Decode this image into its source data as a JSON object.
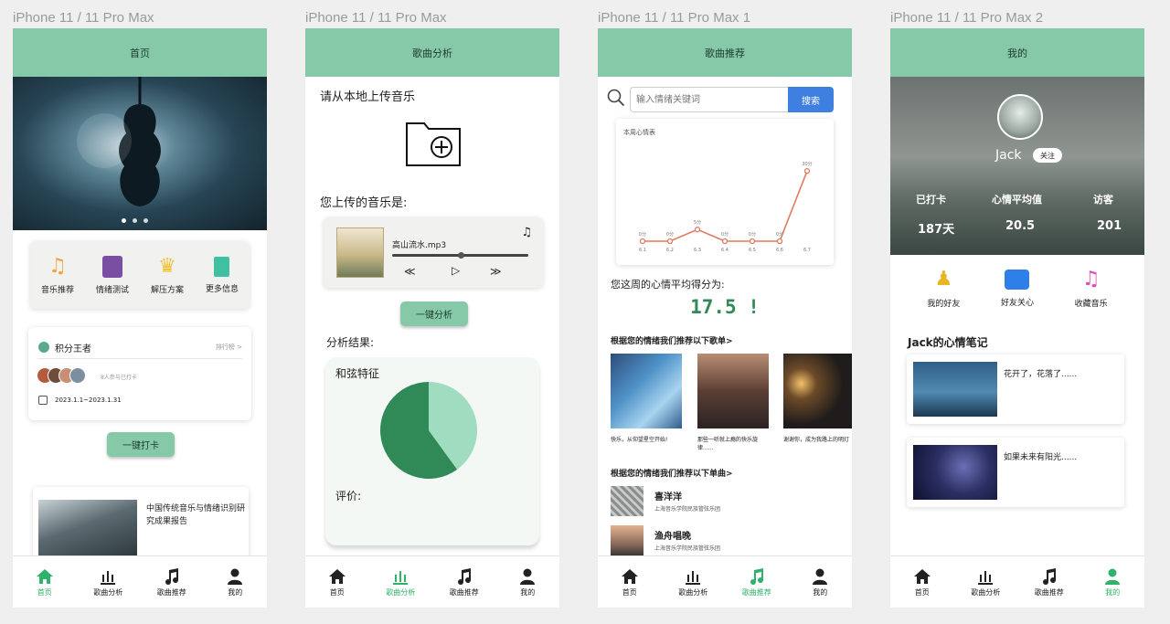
{
  "frames": [
    {
      "label": "iPhone 11 / 11 Pro Max",
      "title": "首页"
    },
    {
      "label": "iPhone 11 / 11 Pro Max",
      "title": "歌曲分析"
    },
    {
      "label": "iPhone 11 / 11 Pro Max 1",
      "title": "歌曲推荐"
    },
    {
      "label": "iPhone 11 / 11 Pro Max 2",
      "title": "我的"
    }
  ],
  "tabs": [
    "首页",
    "歌曲分析",
    "歌曲推荐",
    "我的"
  ],
  "home": {
    "features": [
      "音乐推荐",
      "情绪测试",
      "解压方案",
      "更多信息"
    ],
    "rank_title": "积分王者",
    "rank_link": "排行榜 >",
    "rank_count": "8人参与已打卡",
    "rank_date": "2023.1.1~2023.1.31",
    "checkin_button": "一键打卡",
    "report_title": "中国传统音乐与情绪识别研究成果报告"
  },
  "analysis": {
    "upload_prompt": "请从本地上传音乐",
    "uploaded_label": "您上传的音乐是:",
    "file_name": "高山流水.mp3",
    "progress": 0.5,
    "analyze_button": "一键分析",
    "result_label": "分析结果:",
    "feature_label": "和弦特征",
    "eval_label": "评价:",
    "pie": {
      "light_share": 0.4,
      "light_color": "#9fdcc0",
      "dark_color": "#2f8a58"
    }
  },
  "recommend": {
    "search_placeholder": "输入情绪关键词",
    "search_button": "搜索",
    "chart_title": "本周心情表",
    "score_label": "您这周的心情平均得分为:",
    "score": "17.5 !",
    "playlist_heading": "根据您的情绪我们推荐以下歌单>",
    "playlists": [
      "快乐，从仰望星空开始!",
      "那些一听就上瘾的快乐旋律......",
      "谢谢你，成为我路上的明灯"
    ],
    "single_heading": "根据您的情绪我们推荐以下单曲>",
    "singles": [
      {
        "title": "喜洋洋",
        "artist": "上海音乐学院民族管弦乐团"
      },
      {
        "title": "渔舟唱晚",
        "artist": "上海音乐学院民族管弦乐团"
      }
    ]
  },
  "chart_data": {
    "type": "line",
    "title": "本周心情表",
    "categories": [
      "6.1",
      "6.2",
      "6.3",
      "6.4",
      "6.5",
      "6.6",
      "6.7"
    ],
    "series": [
      {
        "values": [
          0,
          0,
          5,
          0,
          0,
          0,
          30
        ]
      }
    ],
    "data_labels": [
      "0分",
      "0分",
      "5分",
      "0分",
      "0分",
      "0分",
      "30分"
    ],
    "ylim": [
      0,
      32
    ],
    "color": "#e07a5f"
  },
  "mine": {
    "name": "Jack",
    "follow_button": "关注",
    "stats": [
      {
        "label": "已打卡",
        "value": "187天"
      },
      {
        "label": "心情平均值",
        "value": "20.5"
      },
      {
        "label": "访客",
        "value": "201"
      }
    ],
    "menu": [
      "我的好友",
      "好友关心",
      "收藏音乐"
    ],
    "notes_heading": "Jack的心情笔记",
    "notes": [
      "花开了，花落了......",
      "如果未来有阳光......"
    ]
  }
}
